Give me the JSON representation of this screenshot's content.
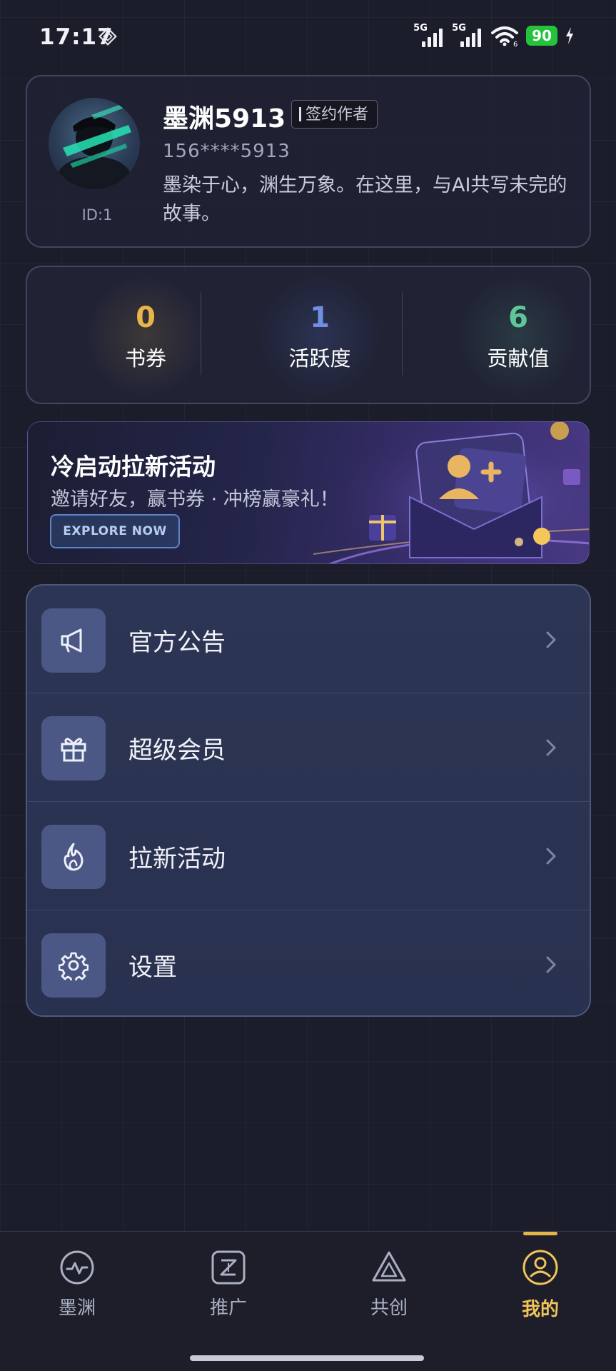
{
  "status_bar": {
    "time": "17:17",
    "signal_1": "5G",
    "signal_2": "5G",
    "battery": "90",
    "icons": [
      "diamond-icon",
      "signal-icon",
      "wifi-icon",
      "battery-icon",
      "charging-icon"
    ]
  },
  "profile": {
    "username": "墨渊5913",
    "badge": "签约作者",
    "phone": "156****5913",
    "bio": "墨染于心，渊生万象。在这里，与AI共写未完的故事。",
    "id_label": "ID:1"
  },
  "stats": [
    {
      "value": "0",
      "label": "书券",
      "color": "#e8b54b"
    },
    {
      "value": "1",
      "label": "活跃度",
      "color": "#6f8fe0"
    },
    {
      "value": "6",
      "label": "贡献值",
      "color": "#5ec79a"
    }
  ],
  "banner": {
    "title": "冷启动拉新活动",
    "subtitle": "邀请好友，赢书券 · 冲榜赢豪礼！",
    "button": "EXPLORE NOW"
  },
  "menu": [
    {
      "label": "官方公告",
      "icon": "megaphone-icon"
    },
    {
      "label": "超级会员",
      "icon": "gift-icon"
    },
    {
      "label": "拉新活动",
      "icon": "flame-icon"
    },
    {
      "label": "设置",
      "icon": "gear-icon"
    }
  ],
  "tabs": [
    {
      "label": "墨渊",
      "icon": "pulse-icon",
      "active": false
    },
    {
      "label": "推广",
      "icon": "promo-icon",
      "active": false
    },
    {
      "label": "共创",
      "icon": "triangle-icon",
      "active": false
    },
    {
      "label": "我的",
      "icon": "user-icon",
      "active": true
    }
  ],
  "colors": {
    "background": "#1c1d2b",
    "accent_gold": "#f0c45a",
    "card": "#2d3554",
    "icon_box": "#4b5785"
  }
}
